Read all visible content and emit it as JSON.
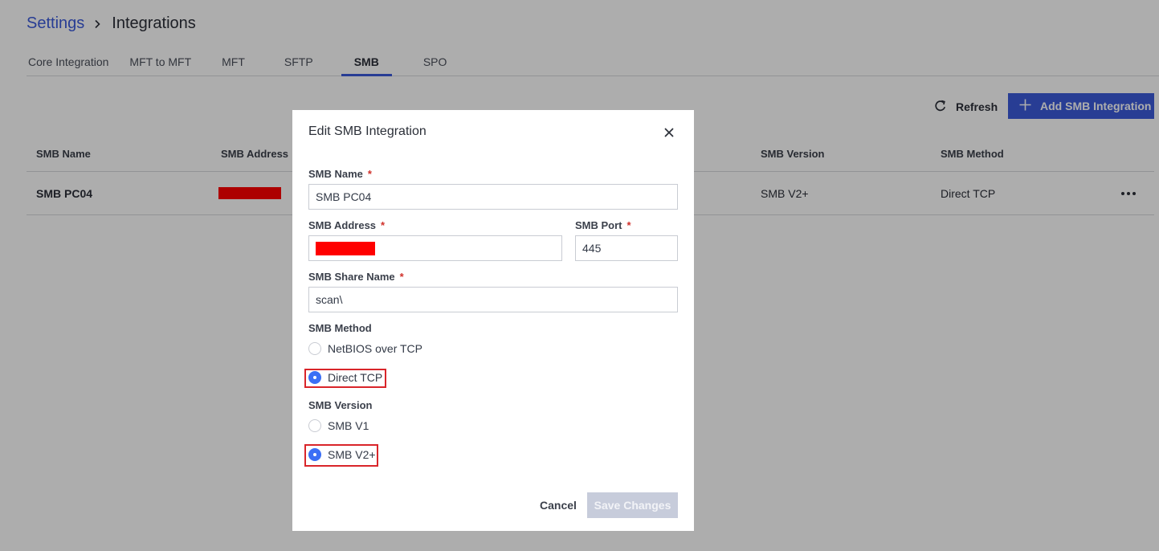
{
  "breadcrumb": {
    "parent": "Settings",
    "current": "Integrations"
  },
  "tabs": [
    {
      "label": "Core Integration",
      "active": false
    },
    {
      "label": "MFT to MFT",
      "active": false
    },
    {
      "label": "MFT",
      "active": false
    },
    {
      "label": "SFTP",
      "active": false
    },
    {
      "label": "SMB",
      "active": true
    },
    {
      "label": "SPO",
      "active": false
    }
  ],
  "toolbar": {
    "refresh_label": "Refresh",
    "add_label": "Add SMB Integration"
  },
  "table": {
    "columns": [
      "SMB Name",
      "SMB Address",
      "SMB Version",
      "SMB Method"
    ],
    "rows": [
      {
        "name": "SMB PC04",
        "address": "",
        "address_redacted": true,
        "version": "SMB V2+",
        "method": "Direct TCP"
      }
    ]
  },
  "modal": {
    "title": "Edit SMB Integration",
    "fields": {
      "name": {
        "label": "SMB Name",
        "value": "SMB PC04",
        "required": "*"
      },
      "address": {
        "label": "SMB Address",
        "value": "",
        "redacted": true,
        "required": "*"
      },
      "port": {
        "label": "SMB Port",
        "value": "445",
        "required": "*"
      },
      "share": {
        "label": "SMB Share Name",
        "value": "scan\\",
        "required": "*"
      }
    },
    "method": {
      "label": "SMB Method",
      "options": [
        {
          "label": "NetBIOS over TCP",
          "selected": false
        },
        {
          "label": "Direct TCP",
          "selected": true
        }
      ]
    },
    "version": {
      "label": "SMB Version",
      "options": [
        {
          "label": "SMB V1",
          "selected": false
        },
        {
          "label": "SMB V2+",
          "selected": true
        }
      ]
    },
    "cancel_label": "Cancel",
    "save_label": "Save Changes"
  },
  "colors": {
    "accent": "#3b5bdb",
    "radio_selected": "#3b6ff5",
    "highlight": "#d9252a",
    "redaction": "#ff0000"
  },
  "icons": {
    "refresh": "refresh-icon",
    "add": "plus-icon",
    "close": "close-icon",
    "more": "more-horizontal-icon",
    "breadcrumb_sep": "chevron-right-icon"
  }
}
